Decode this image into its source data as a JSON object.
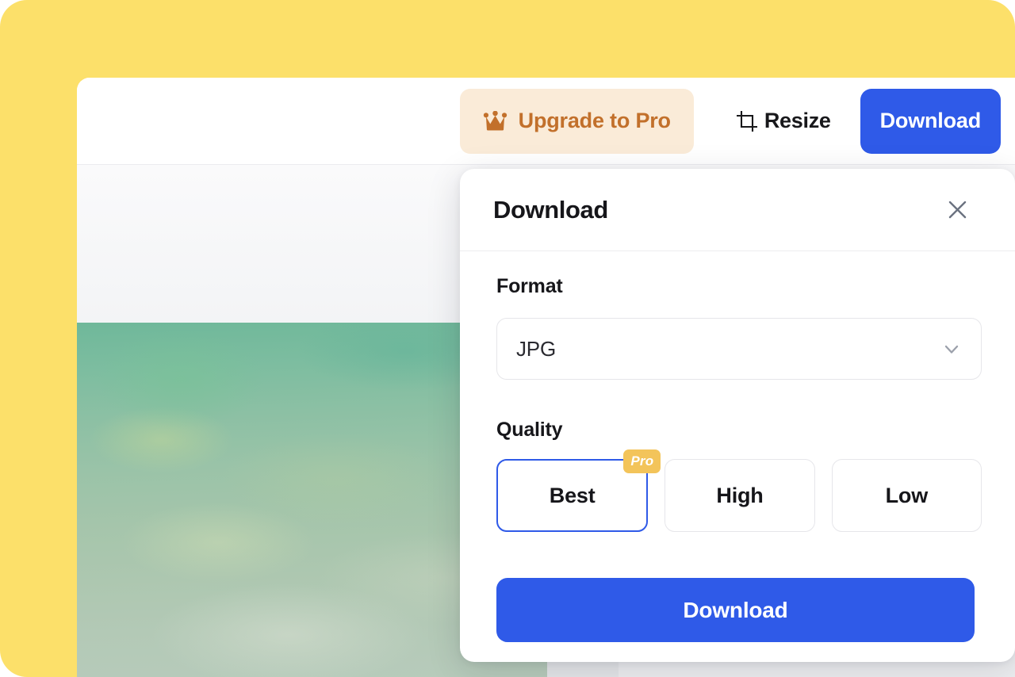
{
  "theme": {
    "backdrop_color": "#FCE06A",
    "primary_blue": "#2F5AE8",
    "pro_orange": "#C2702B",
    "pro_badge_yellow": "#F3C45A",
    "upgrade_bg": "#FAEBD8"
  },
  "toolbar": {
    "upgrade_label": "Upgrade to Pro",
    "upgrade_icon": "crown-icon",
    "resize_label": "Resize",
    "resize_icon": "crop-icon",
    "download_label": "Download"
  },
  "dialog": {
    "title": "Download",
    "close_icon": "close-icon",
    "format": {
      "label": "Format",
      "selected": "JPG",
      "chevron_icon": "chevron-down-icon"
    },
    "quality": {
      "label": "Quality",
      "options": [
        {
          "label": "Best",
          "selected": true,
          "badge": "Pro"
        },
        {
          "label": "High",
          "selected": false,
          "badge": null
        },
        {
          "label": "Low",
          "selected": false,
          "badge": null
        }
      ]
    },
    "submit_label": "Download"
  }
}
